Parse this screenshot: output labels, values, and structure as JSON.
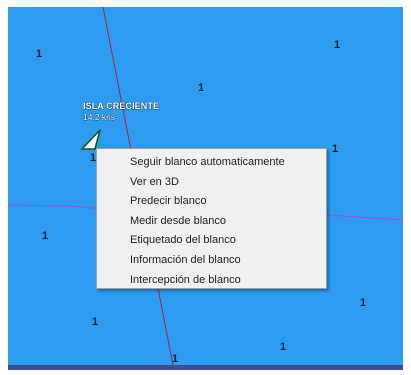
{
  "map": {
    "sea_color": "#2d9cf0",
    "depths": [
      "1",
      "1",
      "1",
      "1",
      "1",
      "1",
      "1",
      "1",
      "1",
      "1"
    ]
  },
  "target": {
    "name": "ISLA CRECIENTE",
    "speed": "14.2 kns",
    "icon": "vessel-triangle-icon"
  },
  "context_menu": {
    "items": [
      "Seguir blanco automaticamente",
      "Ver en 3D",
      "Predecir blanco",
      "Medir desde blanco",
      "Etiquetado del blanco",
      "Información del blanco",
      "Intercepción de blanco"
    ]
  }
}
